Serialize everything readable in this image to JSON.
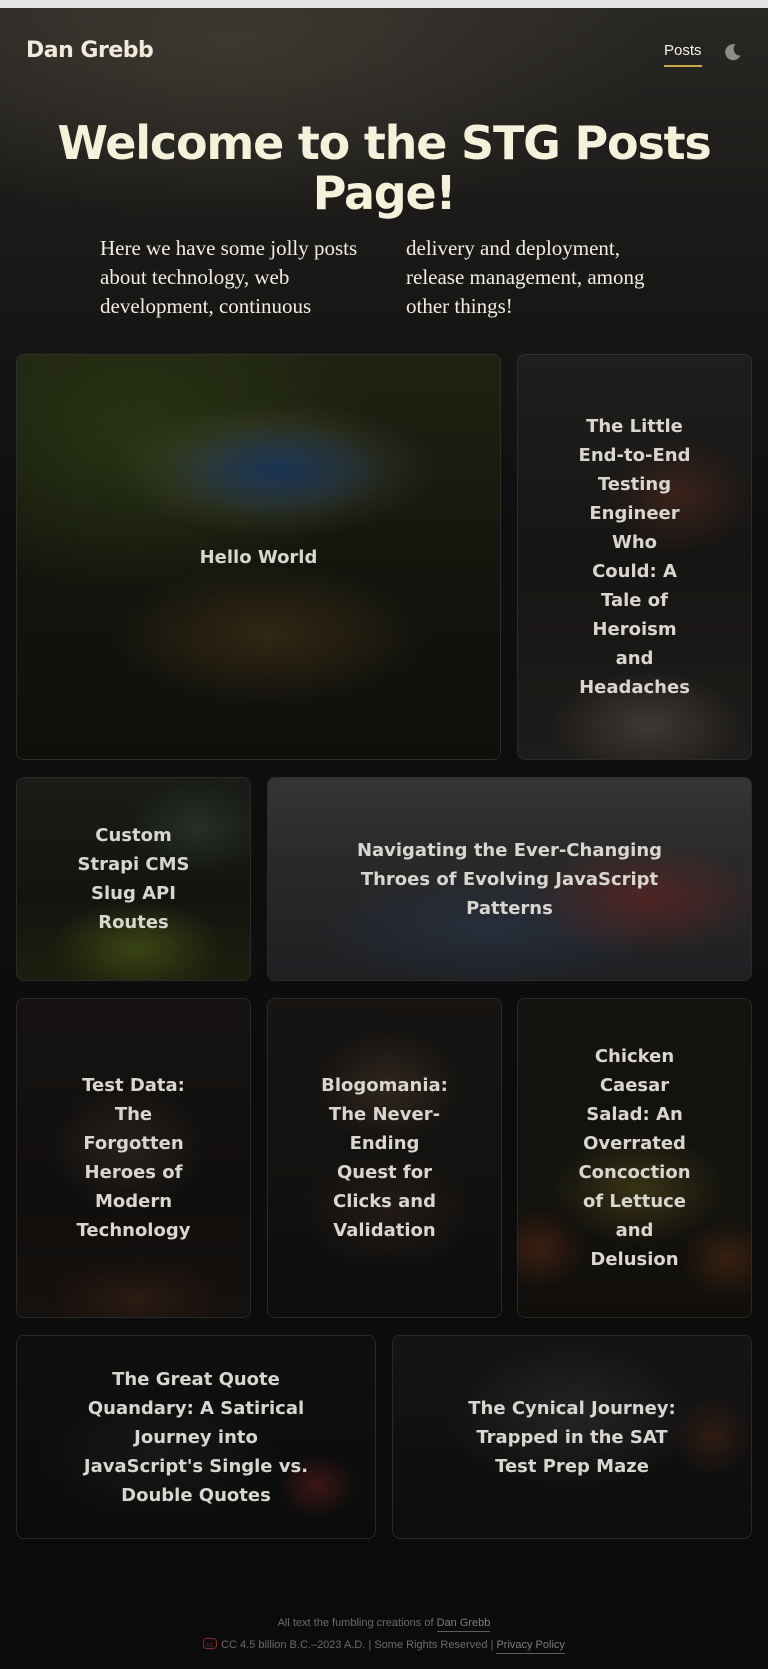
{
  "header": {
    "brand": "Dan Grebb",
    "nav_posts": "Posts"
  },
  "hero": {
    "title": "Welcome to the STG Posts Page!",
    "intro": "Here we have some jolly posts about technology, web development, continuous delivery and deployment, release management, among other things!"
  },
  "posts": [
    {
      "title": "Hello World"
    },
    {
      "title": "The Little End-to-End Testing Engineer Who Could: A Tale of Heroism and Headaches"
    },
    {
      "title": "Custom Strapi CMS Slug API Routes"
    },
    {
      "title": "Navigating the Ever-Changing Throes of Evolving JavaScript Patterns"
    },
    {
      "title": "Test Data: The Forgotten Heroes of Modern Technology"
    },
    {
      "title": "Blogomania: The Never-Ending Quest for Clicks and Validation"
    },
    {
      "title": "Chicken Caesar Salad: An Overrated Concoction of Lettuce and Delusion"
    },
    {
      "title": "The Great Quote Quandary: A Satirical Journey into JavaScript's Single vs. Double Quotes"
    },
    {
      "title": "The Cynical Journey: Trapped in the SAT Test Prep Maze"
    }
  ],
  "footer": {
    "line1_prefix": "All text the fumbling creations of",
    "author_link": "Dan Grebb",
    "license_text": "CC 4.5 billion B.C.–2023 A.D. | Some Rights Reserved |",
    "privacy_link": "Privacy Policy"
  },
  "icons": {
    "theme_toggle": "moon-icon",
    "license": "creative-commons-icon"
  },
  "colors": {
    "nav_underline": "#c8a848",
    "hero_title": "#f6f1db"
  }
}
